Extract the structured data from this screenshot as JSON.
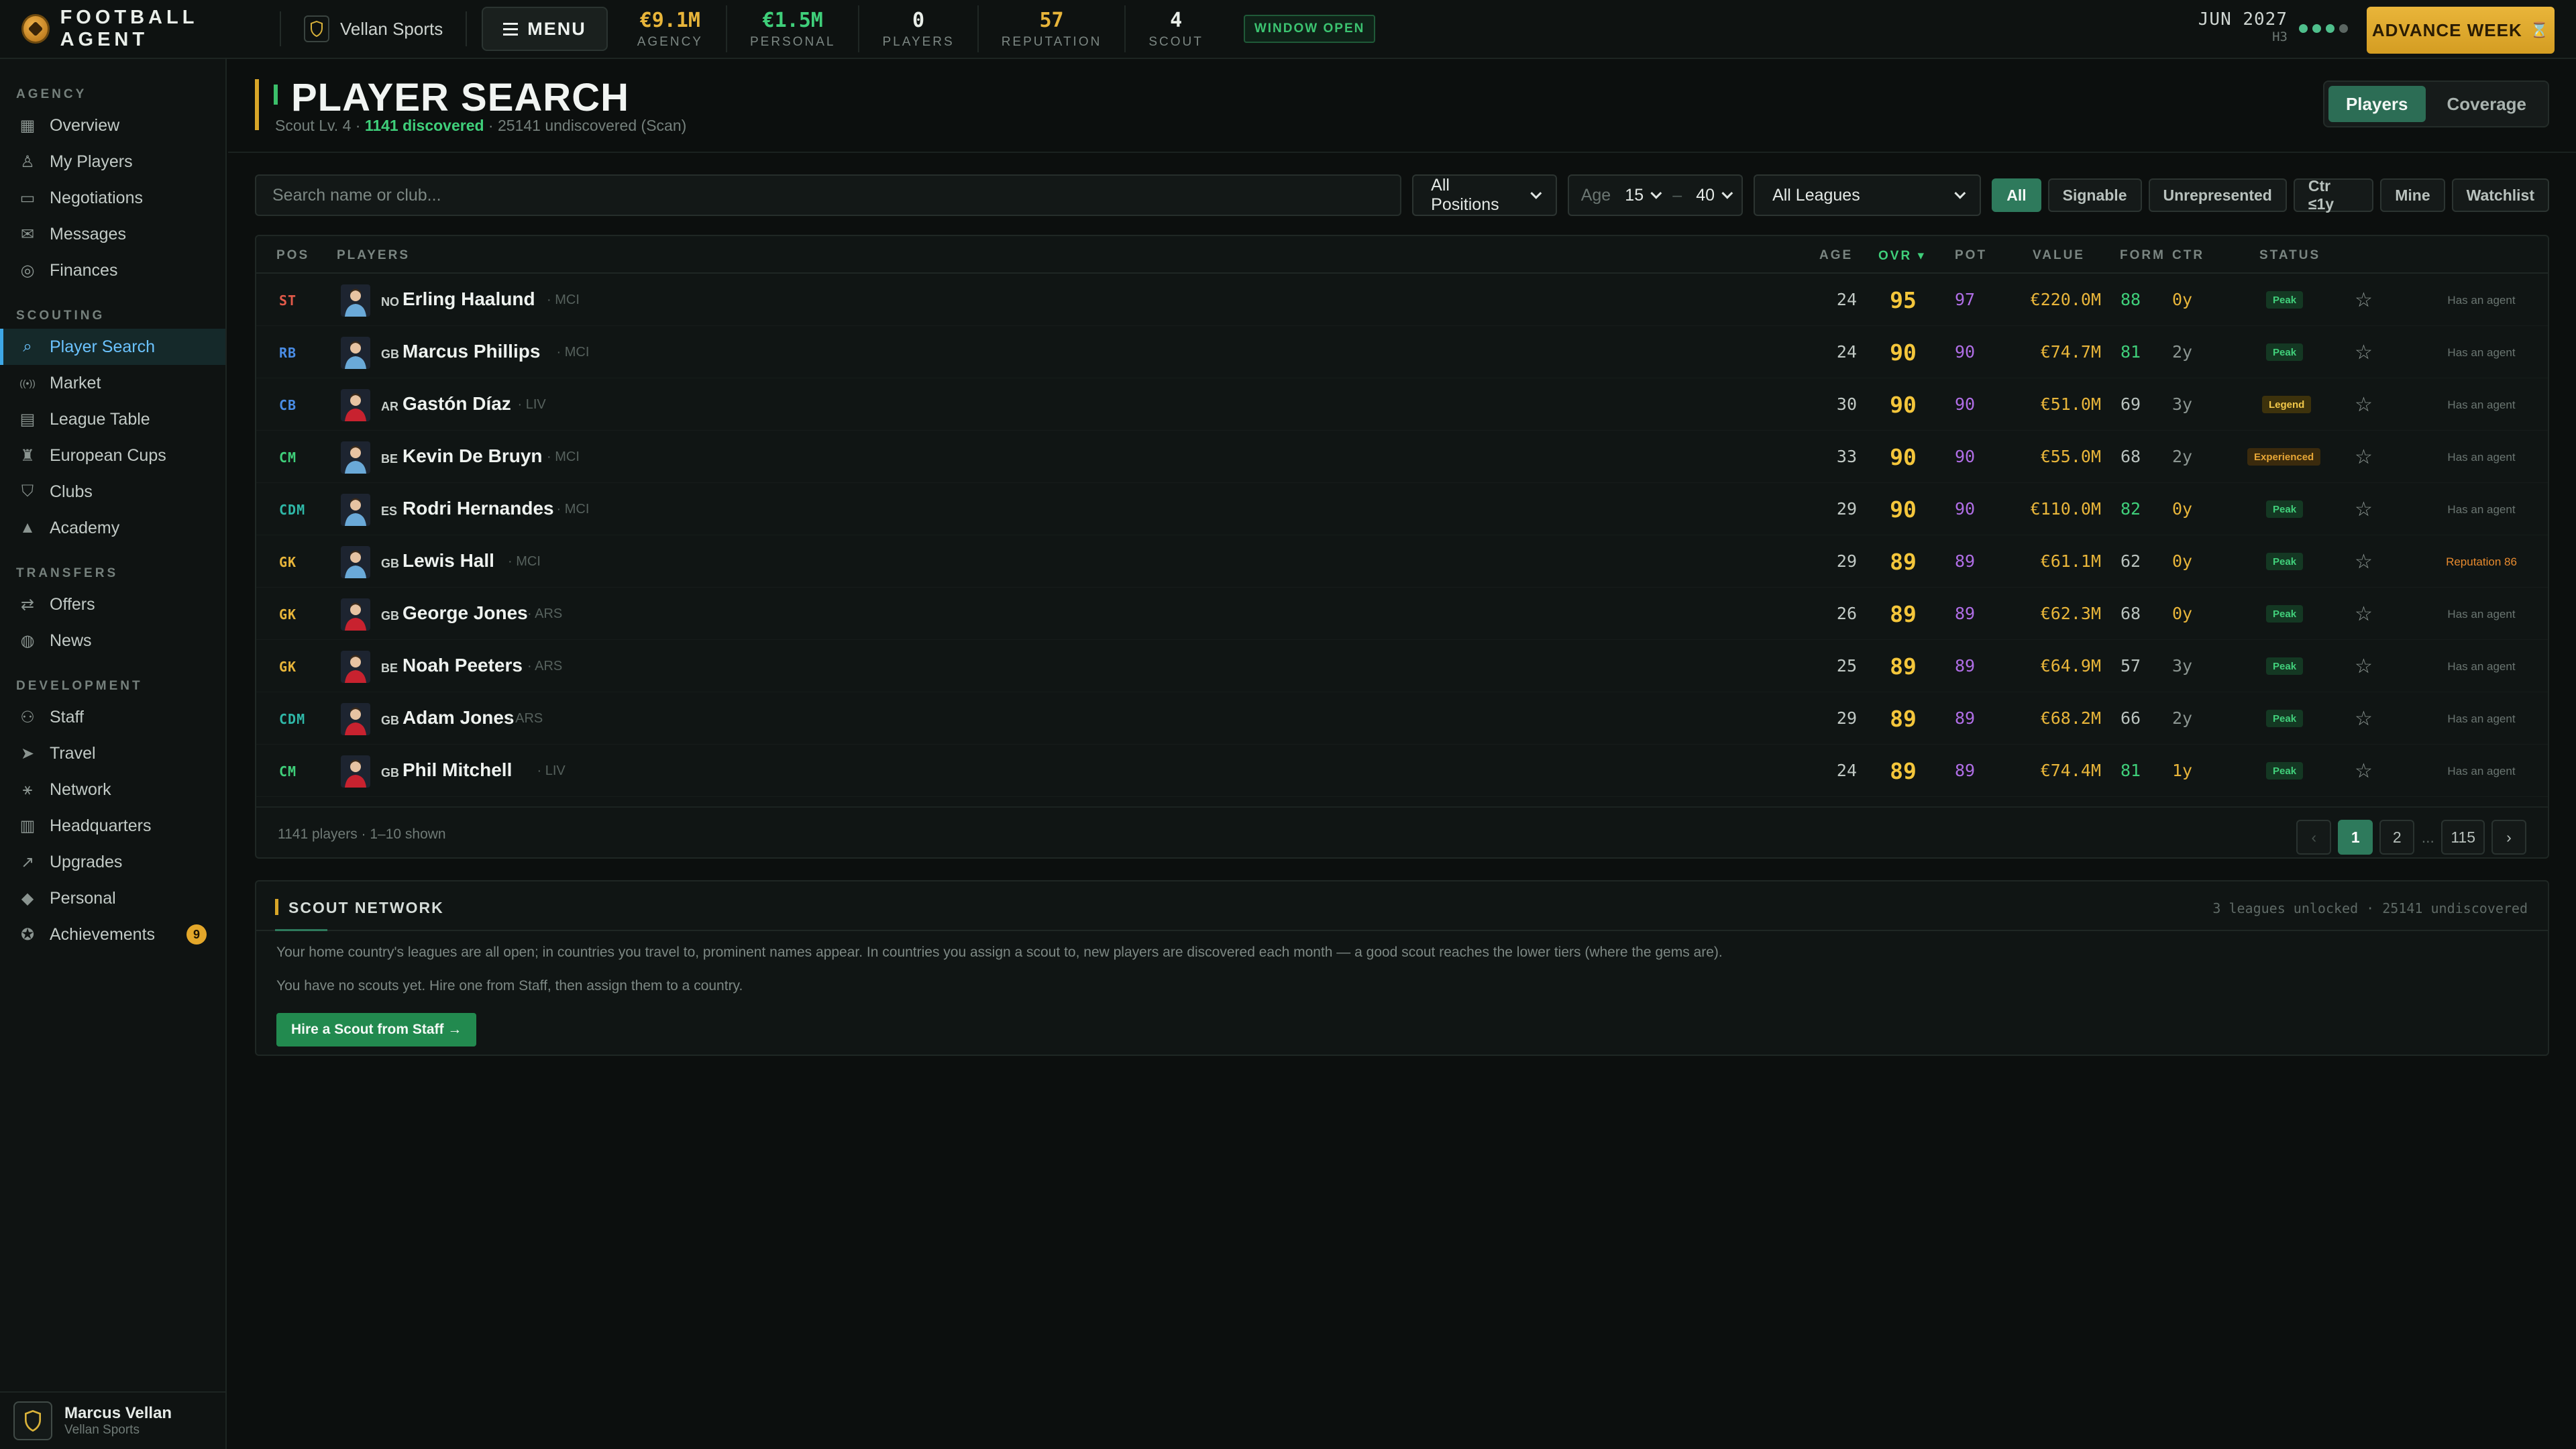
{
  "app": {
    "brand": "FOOTBALL AGENT",
    "agency_name": "Vellan Sports",
    "menu_label": "MENU",
    "stats": [
      {
        "value": "€9.1M",
        "label": "AGENCY",
        "color": "#e8b53a"
      },
      {
        "value": "€1.5M",
        "label": "PERSONAL",
        "color": "#3fcf7a"
      },
      {
        "value": "0",
        "label": "PLAYERS",
        "color": "#e9eee9"
      },
      {
        "value": "57",
        "label": "REPUTATION",
        "color": "#e8b53a"
      },
      {
        "value": "4",
        "label": "SCOUT",
        "color": "#e9eee9"
      }
    ],
    "window_badge": "WINDOW OPEN",
    "date": "JUN 2027",
    "half": "H3",
    "advance_label": "ADVANCE WEEK"
  },
  "sidebar": {
    "sections": [
      {
        "title": "AGENCY",
        "items": [
          {
            "label": "Overview",
            "icon": "grid-icon"
          },
          {
            "label": "My Players",
            "icon": "user-icon"
          },
          {
            "label": "Negotiations",
            "icon": "chat-icon"
          },
          {
            "label": "Messages",
            "icon": "mail-icon"
          },
          {
            "label": "Finances",
            "icon": "coin-icon"
          }
        ]
      },
      {
        "title": "SCOUTING",
        "items": [
          {
            "label": "Player Search",
            "icon": "search-icon",
            "active": true
          },
          {
            "label": "Market",
            "icon": "broadcast-icon"
          },
          {
            "label": "League Table",
            "icon": "table-icon"
          },
          {
            "label": "European Cups",
            "icon": "trophy-icon"
          },
          {
            "label": "Clubs",
            "icon": "shield-icon"
          },
          {
            "label": "Academy",
            "icon": "graduation-icon"
          }
        ]
      },
      {
        "title": "TRANSFERS",
        "items": [
          {
            "label": "Offers",
            "icon": "transfer-icon"
          },
          {
            "label": "News",
            "icon": "globe-icon"
          }
        ]
      },
      {
        "title": "DEVELOPMENT",
        "items": [
          {
            "label": "Staff",
            "icon": "people-icon"
          },
          {
            "label": "Travel",
            "icon": "plane-icon"
          },
          {
            "label": "Network",
            "icon": "network-icon"
          },
          {
            "label": "Headquarters",
            "icon": "building-icon"
          },
          {
            "label": "Upgrades",
            "icon": "trend-icon"
          },
          {
            "label": "Personal",
            "icon": "gem-icon"
          },
          {
            "label": "Achievements",
            "icon": "medal-icon",
            "badge": "9"
          }
        ]
      }
    ],
    "user": {
      "name": "Marcus Vellan",
      "agency": "Vellan Sports"
    }
  },
  "page": {
    "title": "PLAYER SEARCH",
    "sub_prefix": "Scout Lv. 4 · ",
    "discovered": "1141 discovered",
    "sub_suffix": " · 25141 undiscovered (Scan)",
    "toggle": [
      "Players",
      "Coverage"
    ]
  },
  "filters": {
    "search_placeholder": "Search name or club...",
    "position": "All Positions",
    "age_label": "Age",
    "age_min": "15",
    "age_sep": "–",
    "age_max": "40",
    "league": "All Leagues",
    "chips": [
      "All",
      "Signable",
      "Unrepresented",
      "Ctr ≤1y",
      "Mine",
      "Watchlist"
    ]
  },
  "table": {
    "headers": {
      "pos": "POS",
      "players": "PLAYERS",
      "age": "AGE",
      "ovr": "OVR ▾",
      "pot": "POT",
      "value": "VALUE",
      "form": "FORM",
      "ctr": "CTR",
      "status": "STATUS"
    },
    "rows": [
      {
        "pos": "ST",
        "nat": "NO",
        "name": "Erling Haalund",
        "club": "· MCI",
        "age": "24",
        "ovr": "95",
        "pot": "97",
        "value": "€220.0M",
        "form": "88",
        "ctr": "0y",
        "status": "Peak",
        "agent": "Has an agent"
      },
      {
        "pos": "RB",
        "nat": "GB",
        "name": "Marcus Phillips",
        "club": "· MCI",
        "age": "24",
        "ovr": "90",
        "pot": "90",
        "value": "€74.7M",
        "form": "81",
        "ctr": "2y",
        "status": "Peak",
        "agent": "Has an agent"
      },
      {
        "pos": "CB",
        "nat": "AR",
        "name": "Gastón Díaz",
        "club": "· LIV",
        "age": "30",
        "ovr": "90",
        "pot": "90",
        "value": "€51.0M",
        "form": "69",
        "ctr": "3y",
        "status": "Legend",
        "agent": "Has an agent"
      },
      {
        "pos": "CM",
        "nat": "BE",
        "name": "Kevin De Bruyn",
        "club": "· MCI",
        "age": "33",
        "ovr": "90",
        "pot": "90",
        "value": "€55.0M",
        "form": "68",
        "ctr": "2y",
        "status": "Experienced",
        "agent": "Has an agent"
      },
      {
        "pos": "CDM",
        "nat": "ES",
        "name": "Rodri Hernandes",
        "club": "· MCI",
        "age": "29",
        "ovr": "90",
        "pot": "90",
        "value": "€110.0M",
        "form": "82",
        "ctr": "0y",
        "status": "Peak",
        "agent": "Has an agent"
      },
      {
        "pos": "GK",
        "nat": "GB",
        "name": "Lewis Hall",
        "club": "· MCI",
        "age": "29",
        "ovr": "89",
        "pot": "89",
        "value": "€61.1M",
        "form": "62",
        "ctr": "0y",
        "status": "Peak",
        "agent": "Reputation 86"
      },
      {
        "pos": "GK",
        "nat": "GB",
        "name": "George Jones",
        "club": "· ARS",
        "age": "26",
        "ovr": "89",
        "pot": "89",
        "value": "€62.3M",
        "form": "68",
        "ctr": "0y",
        "status": "Peak",
        "agent": "Has an agent"
      },
      {
        "pos": "GK",
        "nat": "BE",
        "name": "Noah Peeters",
        "club": "· ARS",
        "age": "25",
        "ovr": "89",
        "pot": "89",
        "value": "€64.9M",
        "form": "57",
        "ctr": "3y",
        "status": "Peak",
        "agent": "Has an agent"
      },
      {
        "pos": "CDM",
        "nat": "GB",
        "name": "Adam Jones",
        "club": "· ARS",
        "age": "29",
        "ovr": "89",
        "pot": "89",
        "value": "€68.2M",
        "form": "66",
        "ctr": "2y",
        "status": "Peak",
        "agent": "Has an agent"
      },
      {
        "pos": "CM",
        "nat": "GB",
        "name": "Phil Mitchell",
        "club": "· LIV",
        "age": "24",
        "ovr": "89",
        "pot": "89",
        "value": "€74.4M",
        "form": "81",
        "ctr": "1y",
        "status": "Peak",
        "agent": "Has an agent"
      }
    ],
    "count_text": "1141 players · 1–10 shown",
    "pages": [
      "‹",
      "1",
      "2",
      "...",
      "115",
      "›"
    ],
    "pos_colors": {
      "ST": "#e25a4a",
      "RB": "#4a8de6",
      "CB": "#4a8de6",
      "CM": "#3fcf7a",
      "CDM": "#2fb8a8",
      "GK": "#e8b53a"
    },
    "kit_colors": {
      "MCI": "#6aa9d8",
      "LIV": "#c8222f",
      "ARS": "#c8222f"
    }
  },
  "scout": {
    "title": "SCOUT NETWORK",
    "right": "3 leagues unlocked · 25141 undiscovered",
    "p1": "Your home country's leagues are all open; in countries you travel to, prominent names appear. In countries you assign a scout to, new players are discovered each month — a good scout reaches the lower tiers (where the gems are).",
    "p2": "You have no scouts yet. Hire one from Staff, then assign them to a country.",
    "button": "Hire a Scout from Staff →"
  }
}
